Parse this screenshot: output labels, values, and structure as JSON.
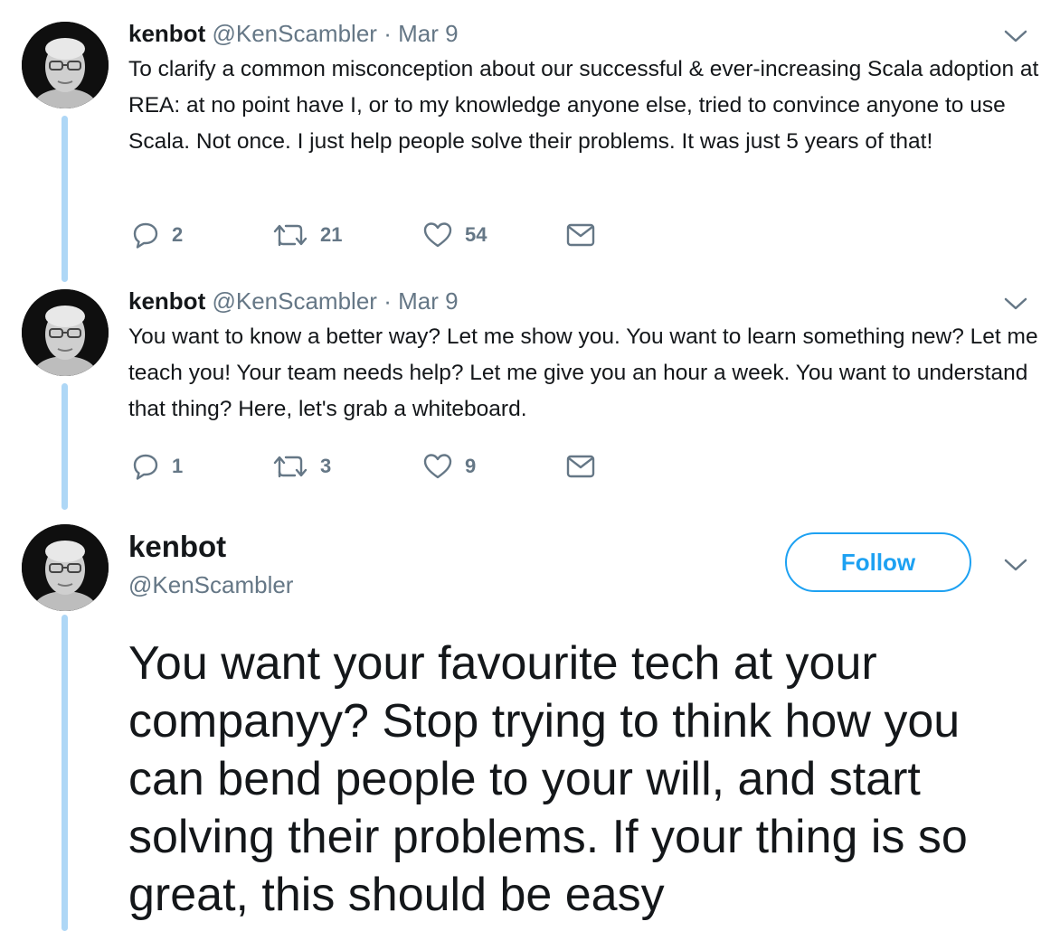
{
  "tweets": [
    {
      "name": "kenbot",
      "handle": "@KenScambler",
      "separator": "·",
      "date": "Mar 9",
      "text": "To clarify a common misconception about our successful & ever-increasing Scala adoption at REA: at no point have I, or to my knowledge anyone else, tried to convince anyone to use Scala. Not once. I just help people solve their problems. It was just 5 years of that!",
      "replies": "2",
      "retweets": "21",
      "likes": "54"
    },
    {
      "name": "kenbot",
      "handle": "@KenScambler",
      "separator": "·",
      "date": "Mar 9",
      "text": "You want to know a better way? Let me show you. You want to learn something new? Let me teach you! Your team needs help? Let me give you an hour a week. You want to understand that thing? Here, let's grab a whiteboard.",
      "replies": "1",
      "retweets": "3",
      "likes": "9"
    }
  ],
  "main_tweet": {
    "name": "kenbot",
    "handle": "@KenScambler",
    "follow_label": "Follow",
    "text": "You want your favourite tech at your companyy? Stop trying to think how you can bend people to your will, and start solving their problems. If your thing is so great, this should be easy"
  },
  "colors": {
    "accent": "#1da1f2",
    "thread_line": "#aed7f6",
    "secondary_text": "#657786",
    "primary_text": "#14171a"
  },
  "icons": {
    "reply": "reply-icon",
    "retweet": "retweet-icon",
    "like": "heart-icon",
    "message": "envelope-icon",
    "menu": "chevron-down-icon"
  }
}
